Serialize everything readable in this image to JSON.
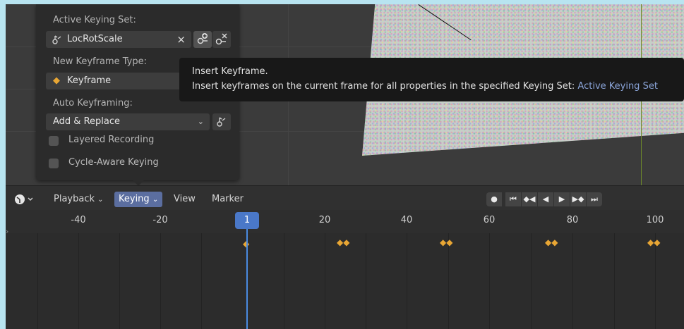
{
  "keying_panel": {
    "active_keying_set_label": "Active Keying Set:",
    "keying_set_value": "LocRotScale",
    "clear_symbol": "×",
    "new_keyframe_type_label": "New Keyframe Type:",
    "keyframe_type_value": "Keyframe",
    "auto_keyframing_label": "Auto Keyframing:",
    "auto_mode_value": "Add & Replace",
    "layered_recording_label": "Layered Recording",
    "cycle_aware_label": "Cycle-Aware Keying"
  },
  "tooltip": {
    "title": "Insert Keyframe.",
    "description": "Insert keyframes on the current frame for all properties in the specified Keying Set:",
    "highlight": "Active Keying Set"
  },
  "header": {
    "menus": [
      "Playback",
      "Keying",
      "View",
      "Marker"
    ],
    "active_menu": "Keying"
  },
  "ruler": {
    "ticks": [
      "-40",
      "-20",
      "20",
      "40",
      "60",
      "80",
      "100"
    ],
    "current_frame": "1"
  },
  "colors": {
    "accent": "#4a78c8",
    "keyframe": "#e8a634",
    "menu_active": "#5b6ea0"
  }
}
